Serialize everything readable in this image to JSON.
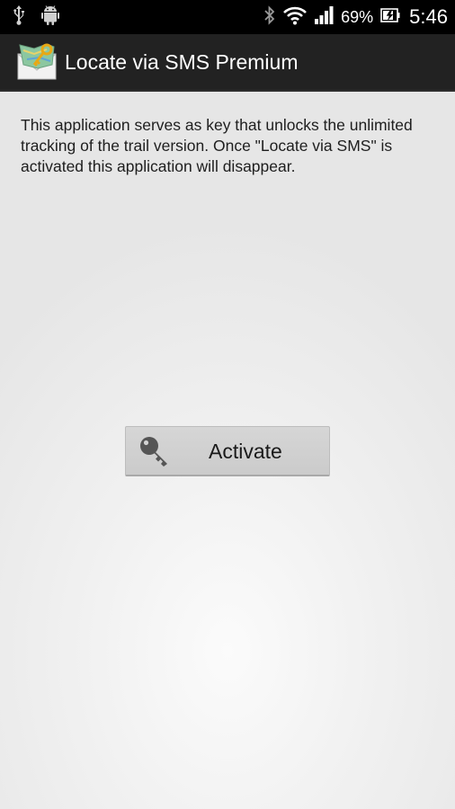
{
  "status_bar": {
    "icons": [
      "usb-icon",
      "android-icon",
      "bluetooth-icon",
      "wifi-icon",
      "signal-icon",
      "battery-icon"
    ],
    "battery_percent": "69%",
    "time": "5:46"
  },
  "action_bar": {
    "title": "Locate via SMS Premium",
    "app_icon": "map-envelope-key-icon"
  },
  "content": {
    "description": "This application serves as key that unlocks the unlimited tracking of the trail version. Once \"Locate via SMS\" is activated this application will disappear.",
    "activate_button": {
      "label": "Activate",
      "icon": "key-icon"
    }
  },
  "colors": {
    "status_bar_bg": "#000000",
    "action_bar_bg": "#222222",
    "button_bg": "#d0d0d0"
  }
}
